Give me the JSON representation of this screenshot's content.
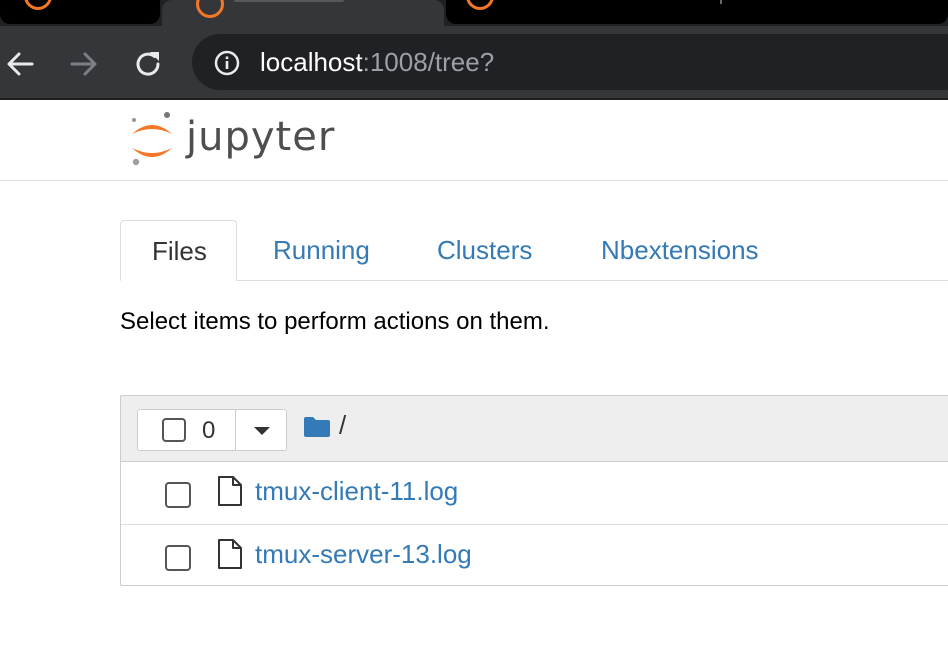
{
  "browser": {
    "address": {
      "host": "localhost",
      "rest": ":1008/tree?"
    },
    "icons": [
      "back-arrow-icon",
      "forward-arrow-icon",
      "reload-icon",
      "info-icon"
    ]
  },
  "header": {
    "logo_text": "jupyter"
  },
  "tabs": [
    {
      "label": "Files",
      "active": true
    },
    {
      "label": "Running",
      "active": false
    },
    {
      "label": "Clusters",
      "active": false
    },
    {
      "label": "Nbextensions",
      "active": false
    }
  ],
  "hint": "Select items to perform actions on them.",
  "file_list": {
    "selected_count": "0",
    "breadcrumb": "/",
    "files": [
      {
        "name": "tmux-client-11.log"
      },
      {
        "name": "tmux-server-13.log"
      }
    ]
  },
  "colors": {
    "link": "#337ab7",
    "jupyter_orange": "#f37726",
    "chrome_toolbar": "#35363a"
  }
}
